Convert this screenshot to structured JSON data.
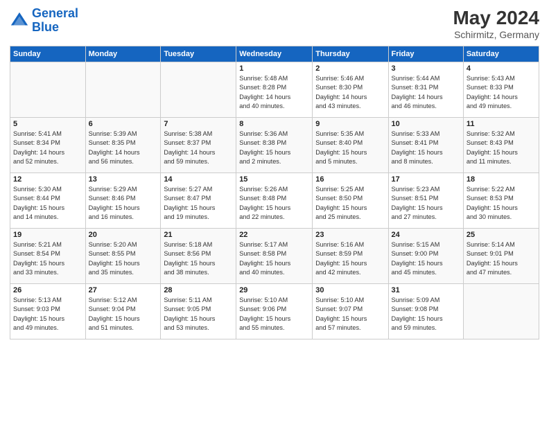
{
  "header": {
    "logo_line1": "General",
    "logo_line2": "Blue",
    "month_year": "May 2024",
    "location": "Schirmitz, Germany"
  },
  "days_of_week": [
    "Sunday",
    "Monday",
    "Tuesday",
    "Wednesday",
    "Thursday",
    "Friday",
    "Saturday"
  ],
  "weeks": [
    [
      {
        "day": "",
        "info": ""
      },
      {
        "day": "",
        "info": ""
      },
      {
        "day": "",
        "info": ""
      },
      {
        "day": "1",
        "info": "Sunrise: 5:48 AM\nSunset: 8:28 PM\nDaylight: 14 hours\nand 40 minutes."
      },
      {
        "day": "2",
        "info": "Sunrise: 5:46 AM\nSunset: 8:30 PM\nDaylight: 14 hours\nand 43 minutes."
      },
      {
        "day": "3",
        "info": "Sunrise: 5:44 AM\nSunset: 8:31 PM\nDaylight: 14 hours\nand 46 minutes."
      },
      {
        "day": "4",
        "info": "Sunrise: 5:43 AM\nSunset: 8:33 PM\nDaylight: 14 hours\nand 49 minutes."
      }
    ],
    [
      {
        "day": "5",
        "info": "Sunrise: 5:41 AM\nSunset: 8:34 PM\nDaylight: 14 hours\nand 52 minutes."
      },
      {
        "day": "6",
        "info": "Sunrise: 5:39 AM\nSunset: 8:35 PM\nDaylight: 14 hours\nand 56 minutes."
      },
      {
        "day": "7",
        "info": "Sunrise: 5:38 AM\nSunset: 8:37 PM\nDaylight: 14 hours\nand 59 minutes."
      },
      {
        "day": "8",
        "info": "Sunrise: 5:36 AM\nSunset: 8:38 PM\nDaylight: 15 hours\nand 2 minutes."
      },
      {
        "day": "9",
        "info": "Sunrise: 5:35 AM\nSunset: 8:40 PM\nDaylight: 15 hours\nand 5 minutes."
      },
      {
        "day": "10",
        "info": "Sunrise: 5:33 AM\nSunset: 8:41 PM\nDaylight: 15 hours\nand 8 minutes."
      },
      {
        "day": "11",
        "info": "Sunrise: 5:32 AM\nSunset: 8:43 PM\nDaylight: 15 hours\nand 11 minutes."
      }
    ],
    [
      {
        "day": "12",
        "info": "Sunrise: 5:30 AM\nSunset: 8:44 PM\nDaylight: 15 hours\nand 14 minutes."
      },
      {
        "day": "13",
        "info": "Sunrise: 5:29 AM\nSunset: 8:46 PM\nDaylight: 15 hours\nand 16 minutes."
      },
      {
        "day": "14",
        "info": "Sunrise: 5:27 AM\nSunset: 8:47 PM\nDaylight: 15 hours\nand 19 minutes."
      },
      {
        "day": "15",
        "info": "Sunrise: 5:26 AM\nSunset: 8:48 PM\nDaylight: 15 hours\nand 22 minutes."
      },
      {
        "day": "16",
        "info": "Sunrise: 5:25 AM\nSunset: 8:50 PM\nDaylight: 15 hours\nand 25 minutes."
      },
      {
        "day": "17",
        "info": "Sunrise: 5:23 AM\nSunset: 8:51 PM\nDaylight: 15 hours\nand 27 minutes."
      },
      {
        "day": "18",
        "info": "Sunrise: 5:22 AM\nSunset: 8:53 PM\nDaylight: 15 hours\nand 30 minutes."
      }
    ],
    [
      {
        "day": "19",
        "info": "Sunrise: 5:21 AM\nSunset: 8:54 PM\nDaylight: 15 hours\nand 33 minutes."
      },
      {
        "day": "20",
        "info": "Sunrise: 5:20 AM\nSunset: 8:55 PM\nDaylight: 15 hours\nand 35 minutes."
      },
      {
        "day": "21",
        "info": "Sunrise: 5:18 AM\nSunset: 8:56 PM\nDaylight: 15 hours\nand 38 minutes."
      },
      {
        "day": "22",
        "info": "Sunrise: 5:17 AM\nSunset: 8:58 PM\nDaylight: 15 hours\nand 40 minutes."
      },
      {
        "day": "23",
        "info": "Sunrise: 5:16 AM\nSunset: 8:59 PM\nDaylight: 15 hours\nand 42 minutes."
      },
      {
        "day": "24",
        "info": "Sunrise: 5:15 AM\nSunset: 9:00 PM\nDaylight: 15 hours\nand 45 minutes."
      },
      {
        "day": "25",
        "info": "Sunrise: 5:14 AM\nSunset: 9:01 PM\nDaylight: 15 hours\nand 47 minutes."
      }
    ],
    [
      {
        "day": "26",
        "info": "Sunrise: 5:13 AM\nSunset: 9:03 PM\nDaylight: 15 hours\nand 49 minutes."
      },
      {
        "day": "27",
        "info": "Sunrise: 5:12 AM\nSunset: 9:04 PM\nDaylight: 15 hours\nand 51 minutes."
      },
      {
        "day": "28",
        "info": "Sunrise: 5:11 AM\nSunset: 9:05 PM\nDaylight: 15 hours\nand 53 minutes."
      },
      {
        "day": "29",
        "info": "Sunrise: 5:10 AM\nSunset: 9:06 PM\nDaylight: 15 hours\nand 55 minutes."
      },
      {
        "day": "30",
        "info": "Sunrise: 5:10 AM\nSunset: 9:07 PM\nDaylight: 15 hours\nand 57 minutes."
      },
      {
        "day": "31",
        "info": "Sunrise: 5:09 AM\nSunset: 9:08 PM\nDaylight: 15 hours\nand 59 minutes."
      },
      {
        "day": "",
        "info": ""
      }
    ]
  ]
}
